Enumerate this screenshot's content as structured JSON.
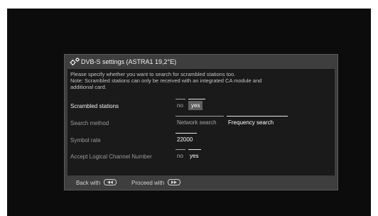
{
  "dialog": {
    "title": "DVB-S settings (ASTRA1 19,2°E)",
    "description": [
      "Please specify whether you want to search for scrambled stations too.",
      "Note: Scrambled stations can only be received with an integrated CA module and",
      "additional card."
    ]
  },
  "settings": {
    "scrambled": {
      "label": "Scrambled stations",
      "options": [
        "no",
        "yes"
      ],
      "selected": "yes"
    },
    "search_method": {
      "label": "Search method",
      "options": [
        "Network search",
        "Frequency search"
      ],
      "selected": "Frequency search"
    },
    "symbol_rate": {
      "label": "Symbol rate",
      "value": "22000"
    },
    "lcn": {
      "label": "Accept Logical Channel Number",
      "options": [
        "no",
        "yes"
      ],
      "selected": "yes"
    }
  },
  "footer": {
    "back_label": "Back with",
    "back_icon": "rewind-button-icon",
    "proceed_label": "Proceed with",
    "proceed_icon": "fast-forward-button-icon"
  }
}
